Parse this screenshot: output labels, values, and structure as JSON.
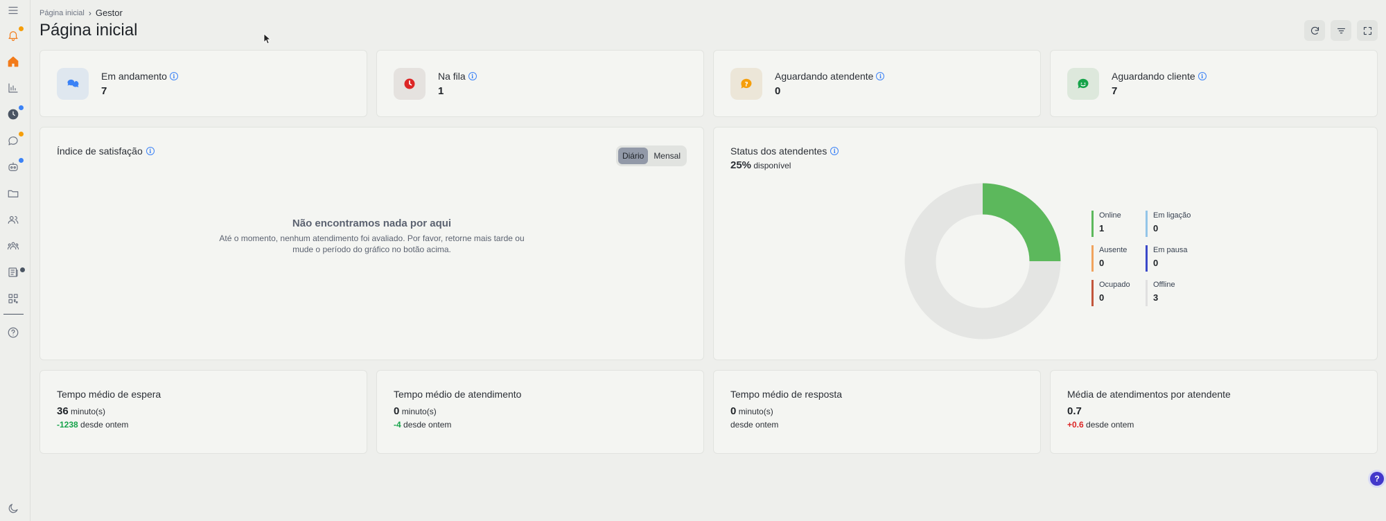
{
  "breadcrumb": {
    "home": "Página inicial",
    "current": "Gestor"
  },
  "page": {
    "title": "Página inicial"
  },
  "stats": [
    {
      "label": "Em andamento",
      "value": "7",
      "icon": "chat-bubbles-icon",
      "color": "#3b82f6"
    },
    {
      "label": "Na fila",
      "value": "1",
      "icon": "clock-icon",
      "color": "#dc2626"
    },
    {
      "label": "Aguardando atendente",
      "value": "0",
      "icon": "question-bubble-icon",
      "color": "#f59e0b"
    },
    {
      "label": "Aguardando cliente",
      "value": "7",
      "icon": "smile-bubble-icon",
      "color": "#16a34a"
    }
  ],
  "satisfaction": {
    "title": "Índice de satisfação",
    "toggle": [
      "Diário",
      "Mensal"
    ],
    "selected": "Diário",
    "empty_title": "Não encontramos nada por aqui",
    "empty_text": "Até o momento, nenhum atendimento foi avaliado. Por favor, retorne mais tarde ou mude o período do gráfico no botão acima."
  },
  "agents_status": {
    "title": "Status dos atendentes",
    "percent": "25%",
    "percent_label": "disponível",
    "legend": [
      {
        "label": "Online",
        "value": "1",
        "color": "#5cb85c"
      },
      {
        "label": "Em ligação",
        "value": "0",
        "color": "#93c5e8"
      },
      {
        "label": "Ausente",
        "value": "0",
        "color": "#f0a35e"
      },
      {
        "label": "Em pausa",
        "value": "0",
        "color": "#3b49c9"
      },
      {
        "label": "Ocupado",
        "value": "0",
        "color": "#c2563c"
      },
      {
        "label": "Offline",
        "value": "3",
        "color": "#e0e0e0"
      }
    ]
  },
  "metrics": [
    {
      "title": "Tempo médio de espera",
      "value": "36",
      "unit": "minuto(s)",
      "delta": "-1238",
      "delta_label": "desde ontem",
      "delta_sign": "neg"
    },
    {
      "title": "Tempo médio de atendimento",
      "value": "0",
      "unit": "minuto(s)",
      "delta": "-4",
      "delta_label": "desde ontem",
      "delta_sign": "neg"
    },
    {
      "title": "Tempo médio de resposta",
      "value": "0",
      "unit": "minuto(s)",
      "delta": "",
      "delta_label": "desde ontem",
      "delta_sign": "none"
    },
    {
      "title": "Média de atendimentos por atendente",
      "value": "0.7",
      "unit": "",
      "delta": "+0.6",
      "delta_label": "desde ontem",
      "delta_sign": "pos"
    }
  ],
  "help": {
    "label": "?"
  }
}
